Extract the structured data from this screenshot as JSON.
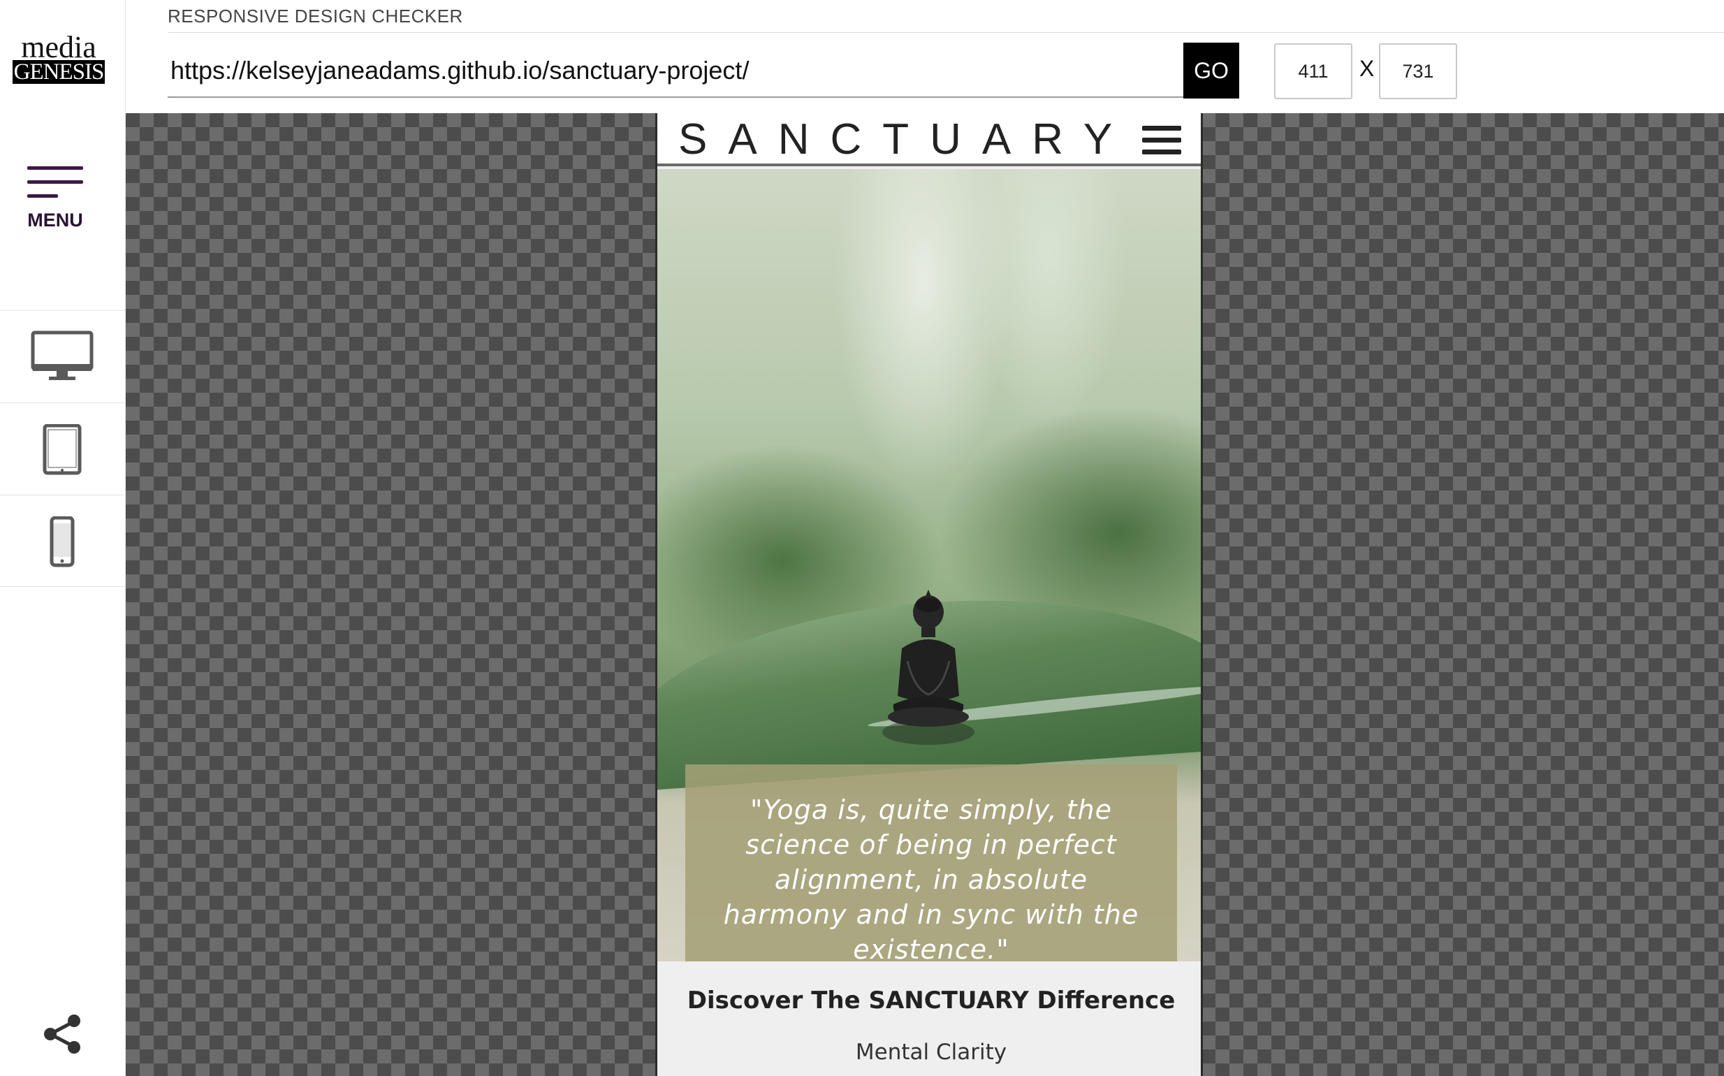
{
  "app": {
    "title": "RESPONSIVE DESIGN CHECKER",
    "logo_top": "media",
    "logo_bottom": "GENESIS"
  },
  "sidebar": {
    "menu_label": "MENU",
    "devices": [
      {
        "name": "desktop",
        "icon": "desktop-monitor-icon"
      },
      {
        "name": "tablet",
        "icon": "tablet-icon"
      },
      {
        "name": "mobile",
        "icon": "mobile-phone-icon"
      }
    ],
    "share_icon": "share-icon",
    "accent_color": "#3b1a47"
  },
  "toolbar": {
    "url_value": "https://kelseyjaneadams.github.io/sanctuary-project/",
    "go_label": "GO",
    "width_value": "411",
    "height_value": "731",
    "dimension_separator": "X"
  },
  "preview": {
    "brand": "SANCTUARY",
    "quote": "\"Yoga is, quite simply, the science of being in perfect alignment, in absolute harmony and in sync with the existence.\"",
    "heading": "Discover The SANCTUARY Difference",
    "subheading": "Mental Clarity",
    "quote_box_color": "#a4a076"
  }
}
